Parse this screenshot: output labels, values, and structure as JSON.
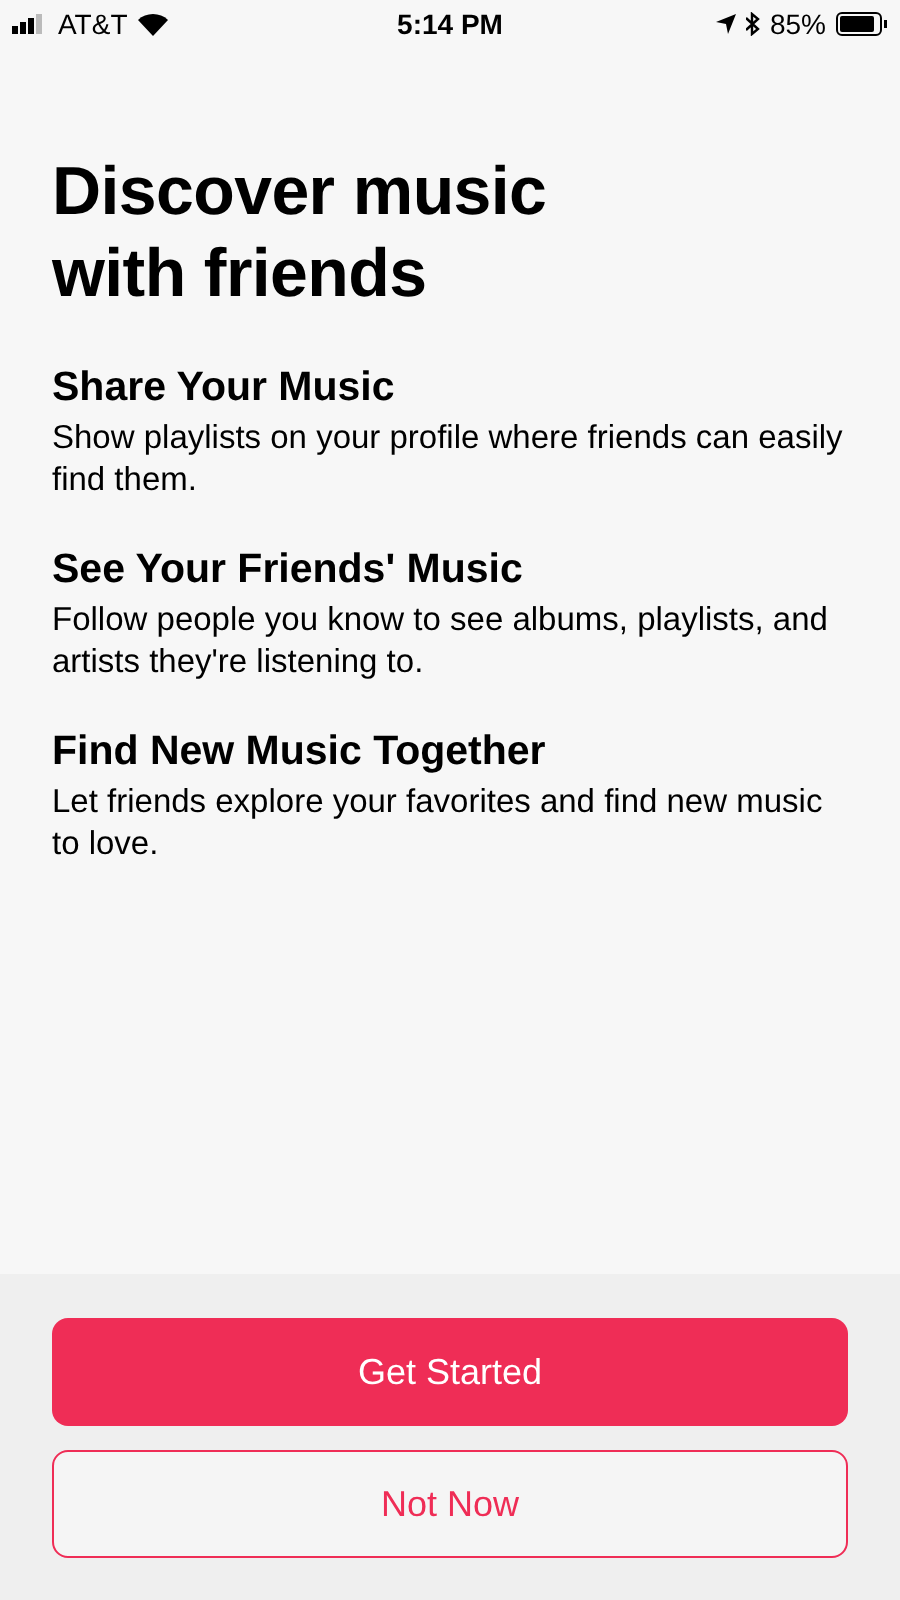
{
  "status_bar": {
    "carrier": "AT&T",
    "time": "5:14 PM",
    "battery": "85%"
  },
  "title": "Discover music with friends",
  "features": [
    {
      "heading": "Share Your Music",
      "text": "Show playlists on your profile where friends can easily find them."
    },
    {
      "heading": "See Your Friends' Music",
      "text": "Follow people you know to see albums, playlists, and artists they're listening to."
    },
    {
      "heading": "Find New Music Together",
      "text": "Let friends explore your favorites and find new music to love."
    }
  ],
  "buttons": [
    {
      "label": "Get Started",
      "kind": "primary"
    },
    {
      "label": "Not Now",
      "kind": "secondary"
    }
  ]
}
